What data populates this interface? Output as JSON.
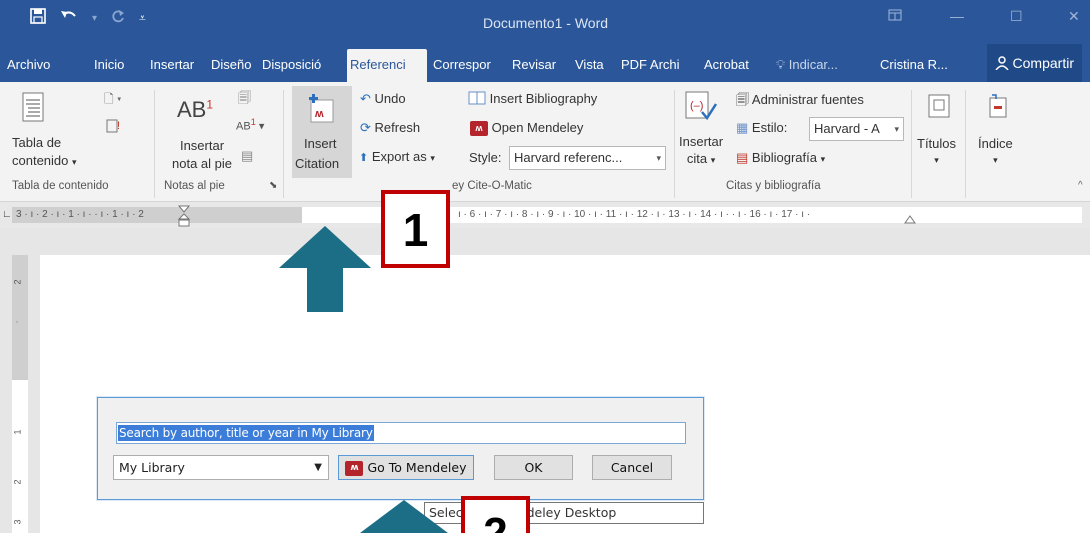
{
  "window": {
    "title": "Documento1 - Word",
    "qat_icons": [
      "save-icon",
      "undo-icon",
      "redo-icon",
      "customize-icon"
    ]
  },
  "tabs": [
    "Archivo",
    "Inicio",
    "Insertar",
    "Diseño",
    "Disposició",
    "Referenci",
    "Correspor",
    "Revisar",
    "Vista",
    "PDF Archi",
    "Acrobat",
    "Indicar...",
    "Cristina R...",
    "Compartir"
  ],
  "active_tab": "Referenci",
  "ribbon": {
    "toc": {
      "label1": "Tabla de",
      "label2": "contenido",
      "group": "Tabla de contenido"
    },
    "footnotes": {
      "label1": "Insertar",
      "label2": "nota al pie",
      "ab": "AB",
      "group": "Notas al pie"
    },
    "mendeley": {
      "insert1": "Insert",
      "insert2": "Citation",
      "undo": "Undo",
      "refresh": "Refresh",
      "export": "Export as",
      "insert_bib": "Insert Bibliography",
      "open": "Open Mendeley",
      "style_label": "Style:",
      "style_value": "Harvard referenc...",
      "group": "ey Cite-O-Matic"
    },
    "citations": {
      "insert1": "Insertar",
      "insert2": "cita",
      "manage": "Administrar fuentes",
      "style_label": "Estilo:",
      "style_value": "Harvard - A",
      "bibliography": "Bibliografía",
      "group": "Citas y bibliografía"
    },
    "titles": "Títulos",
    "index": "Índice"
  },
  "ruler": {
    "text": "3 · ı · 2 · ı · 1 · ı ·     · ı · 1 · ı · 2",
    "text2": "ı · 6 · ı · 7 · ı · 8 · ı · 9 · ı · 10 · ı · 11 · ı · 12 · ı · 13 · ı · 14 · ı ·      · ı · 16 · ı · 17 · ı ·"
  },
  "callouts": {
    "one": "1",
    "two": "2"
  },
  "dialog": {
    "search_placeholder": "Search by author, title or year in My Library",
    "library": "My Library",
    "go_to": "Go To Mendeley",
    "ok": "OK",
    "cancel": "Cancel"
  },
  "tooltip": "Selec          es in Mendeley Desktop",
  "colors": {
    "word_blue": "#2b579a",
    "arrow": "#1c6e86",
    "callout_red": "#c00000",
    "mendeley_red": "#b3242b"
  }
}
